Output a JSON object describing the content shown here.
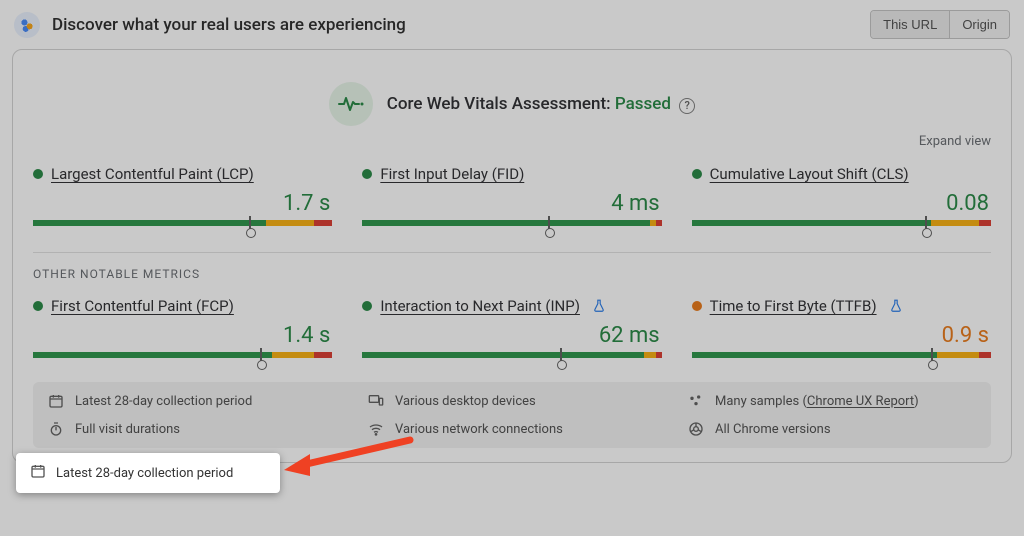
{
  "header": {
    "title": "Discover what your real users are experiencing",
    "tabs": {
      "this_url": "This URL",
      "origin": "Origin"
    }
  },
  "assessment": {
    "label": "Core Web Vitals Assessment:",
    "status": "Passed"
  },
  "expand_label": "Expand view",
  "core_metrics": [
    {
      "name": "Largest Contentful Paint (LCP)",
      "value": "1.7 s",
      "status": "green",
      "marker_pct": 72,
      "segments": [
        78,
        16,
        6
      ]
    },
    {
      "name": "First Input Delay (FID)",
      "value": "4 ms",
      "status": "green",
      "marker_pct": 62,
      "segments": [
        96,
        2,
        2
      ]
    },
    {
      "name": "Cumulative Layout Shift (CLS)",
      "value": "0.08",
      "status": "green",
      "marker_pct": 78,
      "segments": [
        80,
        16,
        4
      ]
    }
  ],
  "other_label": "OTHER NOTABLE METRICS",
  "other_metrics": [
    {
      "name": "First Contentful Paint (FCP)",
      "value": "1.4 s",
      "status": "green",
      "marker_pct": 76,
      "segments": [
        80,
        14,
        6
      ],
      "experimental": false
    },
    {
      "name": "Interaction to Next Paint (INP)",
      "value": "62 ms",
      "status": "green",
      "marker_pct": 66,
      "segments": [
        94,
        4,
        2
      ],
      "experimental": true
    },
    {
      "name": "Time to First Byte (TTFB)",
      "value": "0.9 s",
      "status": "amber",
      "marker_pct": 80,
      "segments": [
        82,
        14,
        4
      ],
      "experimental": true
    }
  ],
  "footer": {
    "period": "Latest 28-day collection period",
    "devices": "Various desktop devices",
    "samples_prefix": "Many samples",
    "samples_link": "Chrome UX Report",
    "durations": "Full visit durations",
    "network": "Various network connections",
    "versions": "All Chrome versions"
  }
}
